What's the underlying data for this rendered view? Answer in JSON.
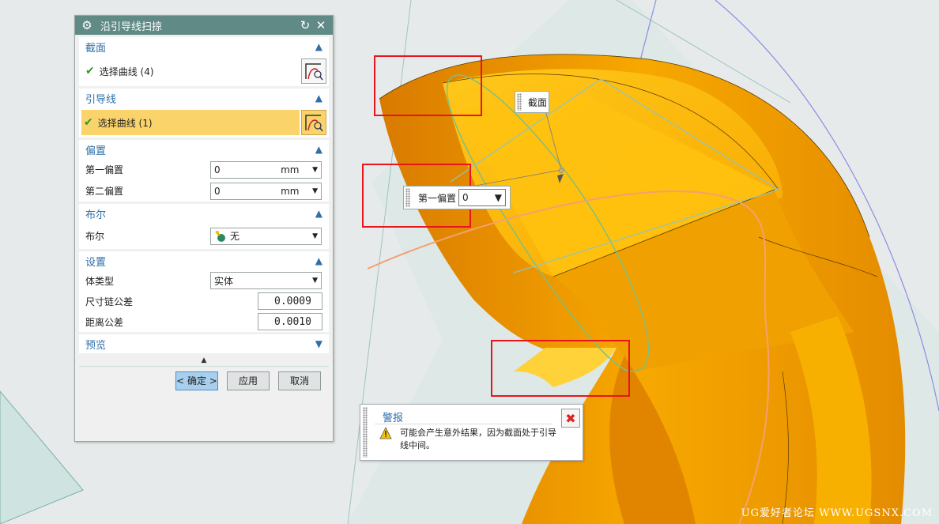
{
  "dialog": {
    "title": "沿引导线扫掠",
    "section_icon": "gear-icon",
    "reset_icon": "refresh-icon",
    "close_icon": "close-icon",
    "section": {
      "header": "截面",
      "select_label": "选择曲线 (4)"
    },
    "guide": {
      "header": "引导线",
      "select_label": "选择曲线 (1)"
    },
    "offset": {
      "header": "偏置",
      "first_label": "第一偏置",
      "first_value": "0",
      "first_unit": "mm",
      "second_label": "第二偏置",
      "second_value": "0",
      "second_unit": "mm"
    },
    "boolean": {
      "header": "布尔",
      "label": "布尔",
      "value": "无"
    },
    "settings": {
      "header": "设置",
      "body_type_label": "体类型",
      "body_type_value": "实体",
      "chain_tol_label": "尺寸链公差",
      "chain_tol_value": "0.0009",
      "dist_tol_label": "距离公差",
      "dist_tol_value": "0.0010"
    },
    "preview": {
      "header": "预览"
    },
    "buttons": {
      "ok": "< 确定 >",
      "apply": "应用",
      "cancel": "取消"
    }
  },
  "canvas": {
    "section_tag": "截面",
    "offset_tag_label": "第一偏置",
    "offset_tag_value": "0"
  },
  "warning": {
    "title": "警报",
    "message": "可能会产生意外结果，因为截面处于引导线中间。"
  },
  "watermark": "UG爱好者论坛 WWW.UGSNX.COM",
  "colors": {
    "title_bar": "#5f8a85",
    "header_text": "#2f6fa8",
    "active_row": "#fad46b",
    "model_orange": "#f5a000",
    "highlight_red": "#e8141e"
  }
}
